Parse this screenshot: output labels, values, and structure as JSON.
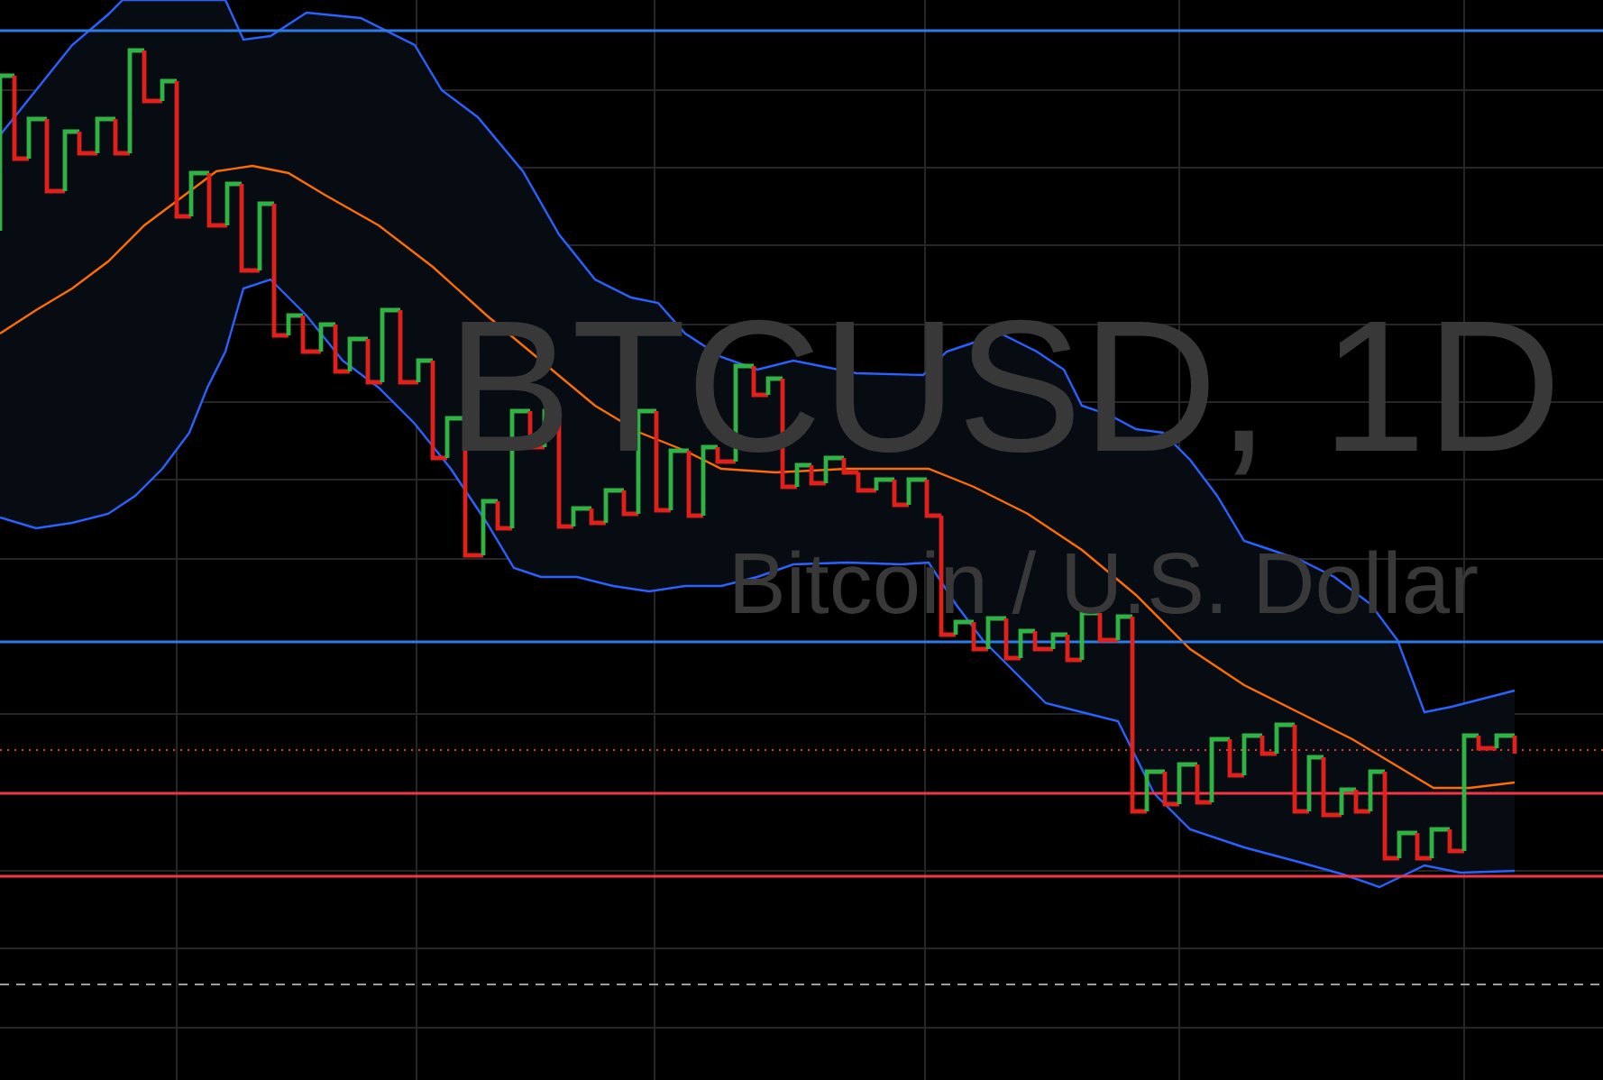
{
  "chart": {
    "symbol_title": "BTCUSD, 1D",
    "symbol_description": "Bitcoin / U.S. Dollar"
  }
}
